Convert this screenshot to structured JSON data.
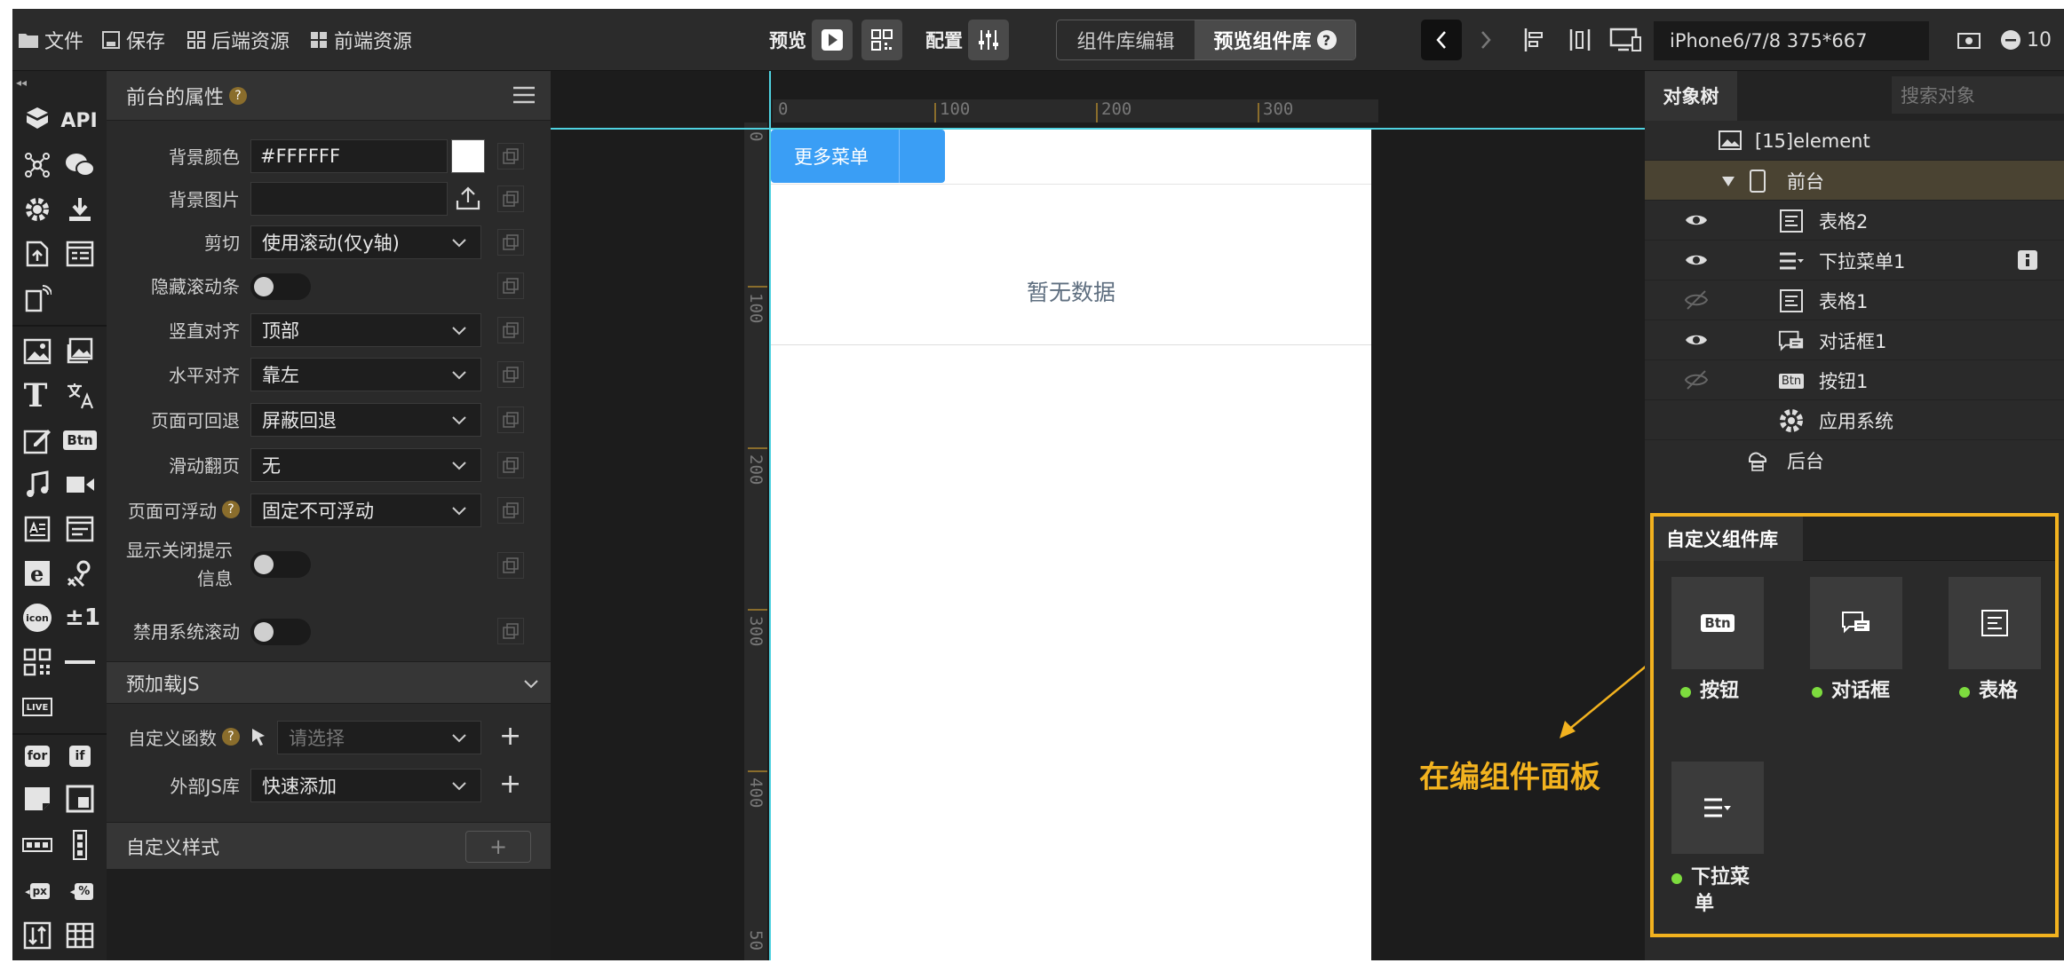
{
  "toolbar": {
    "file": "文件",
    "save": "保存",
    "backend_resources": "后端资源",
    "frontend_resources": "前端资源",
    "preview": "预览",
    "config": "配置",
    "lib_edit": "组件库编辑",
    "lib_preview": "预览组件库",
    "help_glyph": "?",
    "device": "iPhone6/7/8 375*667",
    "zoom": "10"
  },
  "iconbar": {
    "api": "API",
    "btn": "Btn",
    "text_t": "T",
    "icon": "icon",
    "plusminus": "±1",
    "live": "LIVE",
    "for": "for",
    "if": "if",
    "px": "px",
    "percent": "%"
  },
  "props": {
    "title": "前台的属性",
    "help_glyph": "?",
    "rows": [
      {
        "label": "背景颜色",
        "value": "#FFFFFF"
      },
      {
        "label": "背景图片",
        "value": ""
      },
      {
        "label": "剪切",
        "value": "使用滚动(仅y轴)"
      },
      {
        "label": "隐藏滚动条",
        "value": ""
      },
      {
        "label": "竖直对齐",
        "value": "顶部"
      },
      {
        "label": "水平对齐",
        "value": "靠左"
      },
      {
        "label": "页面可回退",
        "value": "屏蔽回退"
      },
      {
        "label": "滑动翻页",
        "value": "无"
      },
      {
        "label": "页面可浮动",
        "value": "固定不可浮动"
      },
      {
        "label": "显示关闭提示信息",
        "value": ""
      },
      {
        "label": "禁用系统滚动",
        "value": ""
      }
    ],
    "preload_js": "预加载JS",
    "custom_func_label": "自定义函数",
    "custom_func_placeholder": "请选择",
    "external_js_label": "外部JS库",
    "external_js_value": "快速添加",
    "custom_style": "自定义样式",
    "add_glyph": "+"
  },
  "canvas": {
    "ruler_top": [
      "0",
      "100",
      "200",
      "300"
    ],
    "ruler_left": [
      "0",
      "100",
      "200",
      "300",
      "400",
      "50"
    ],
    "more_menu": "更多菜单",
    "empty_text": "暂无数据"
  },
  "tree": {
    "tab": "对象树",
    "search_placeholder": "搜索对象",
    "nodes": [
      {
        "label": "[15]element",
        "eye": "none"
      },
      {
        "label": "前台",
        "eye": "none"
      },
      {
        "label": "表格2",
        "eye": "visible"
      },
      {
        "label": "下拉菜单1",
        "eye": "visible"
      },
      {
        "label": "表格1",
        "eye": "hidden"
      },
      {
        "label": "对话框1",
        "eye": "visible"
      },
      {
        "label": "按钮1",
        "eye": "hidden"
      },
      {
        "label": "应用系统",
        "eye": "none"
      },
      {
        "label": "后台",
        "eye": "none"
      }
    ],
    "btn_badge": "Btn"
  },
  "custom_lib": {
    "title": "自定义组件库",
    "items": [
      {
        "label": "按钮",
        "icon": "button-icon"
      },
      {
        "label": "对话框",
        "icon": "dialog-icon"
      },
      {
        "label": "表格",
        "icon": "table-icon"
      },
      {
        "label": "下拉菜单",
        "label_line1": "下拉菜",
        "label_line2": "单",
        "icon": "dropdown-icon"
      }
    ],
    "btn_badge": "Btn"
  },
  "annotation": "在编组件面板",
  "colors": {
    "accent_blue": "#3a9ef5",
    "highlight_yellow": "#f2b21f",
    "guide_cyan": "#4fd2e0",
    "status_green": "#7ddc3e"
  }
}
